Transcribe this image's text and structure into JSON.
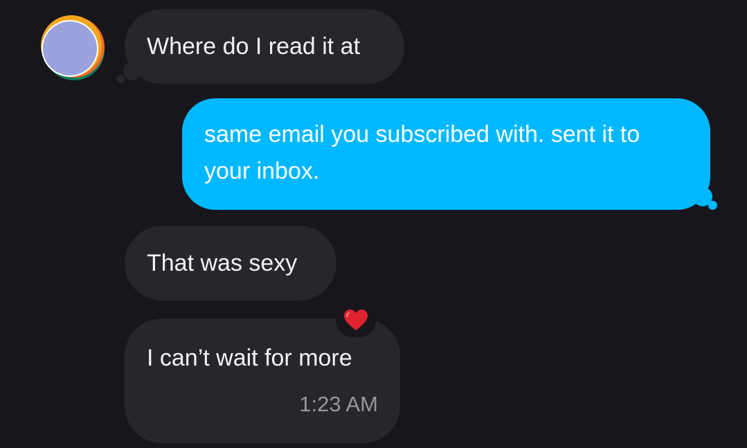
{
  "contact": {
    "avatar_icon": "gradient-circle-avatar",
    "colors": [
      "#9aa3dd",
      "#f2a61d",
      "#ef6a29",
      "#0f7a5d"
    ]
  },
  "messages": [
    {
      "direction": "incoming",
      "text": "Where do I read it at"
    },
    {
      "direction": "outgoing",
      "text": "same email you subscribed with. sent it to your inbox."
    },
    {
      "direction": "incoming",
      "text": "That was sexy"
    },
    {
      "direction": "incoming",
      "text": "I can’t wait for more",
      "timestamp": "1:23 AM",
      "reaction": "red-heart-icon"
    }
  ],
  "theme": {
    "background": "#17161c",
    "incoming_bubble": "#27262d",
    "outgoing_bubble": "#00b8ff",
    "reaction_color": "#e0242f"
  }
}
